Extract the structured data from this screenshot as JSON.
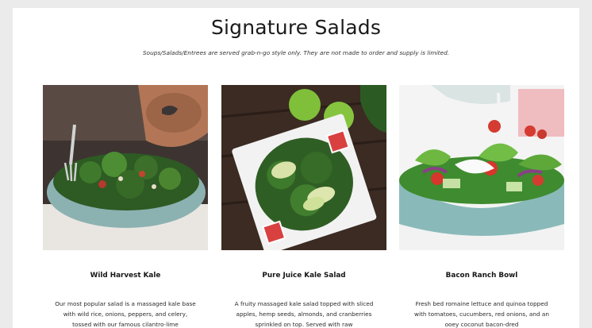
{
  "header": {
    "title": "Signature Salads",
    "notice": "Soups/Salads/Entrees are served grab-n-go style only. They are not made to order and supply is limited."
  },
  "salads": [
    {
      "name": "Wild Harvest Kale",
      "description": "Our most popular salad is a massaged kale base with wild rice, onions, peppers, and celery, tossed with our famous cilantro-lime"
    },
    {
      "name": "Pure Juice Kale Salad",
      "description": "A fruity massaged kale salad topped with sliced apples, hemp seeds, almonds, and cranberries sprinkled on top. Served with raw"
    },
    {
      "name": "Bacon Ranch Bowl",
      "description": "Fresh bed romaine lettuce and quinoa topped with tomatoes, cucumbers, red onions, and an ooey coconut bacon-dred"
    }
  ],
  "colors": {
    "background": "#ebebeb",
    "panel": "#ffffff",
    "text": "#111111"
  }
}
